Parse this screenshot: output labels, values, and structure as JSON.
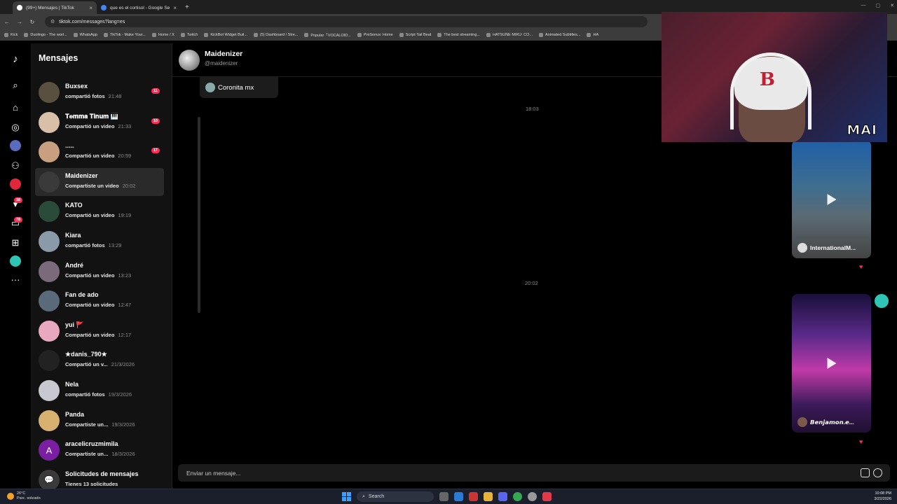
{
  "browser": {
    "tabs": [
      {
        "title": "(99+) Mensajes | TikTok",
        "active": true
      },
      {
        "title": "que es el cortisol - Google Sear",
        "active": false
      }
    ],
    "url": "tiktok.com/messages?lang=es",
    "bookmarks": [
      "Kick",
      "Duolingo - The worl...",
      "WhatsApp",
      "TikTok - Make Your...",
      "Home / X",
      "Twitch",
      "KickBot Widget Buil...",
      "(5) Dashboard / Stre...",
      "Popular「VOCALOID...",
      "PreSonus: Home",
      "Script Tail Beat",
      "The best streaming...",
      "HATSUNE MIKU: CO...",
      "Animated Subtitles...",
      "HA"
    ]
  },
  "rail": {
    "badges": {
      "notifications": "38",
      "messages": "78"
    }
  },
  "sidebar": {
    "title": "Mensajes",
    "conversations": [
      {
        "name": "Buxsex",
        "preview": "compartió fotos",
        "time": "21:48",
        "badge": "11",
        "initial": ""
      },
      {
        "name": "𝐓𝐞𝐦𝐦𝐚 𝐓𝐢𝐧𝐮𝐦 🎹",
        "preview": "Compartió un video",
        "time": "21:33",
        "badge": "10",
        "initial": ""
      },
      {
        "name": ".....",
        "preview": "Compartió un video",
        "time": "20:59",
        "badge": "17",
        "initial": ""
      },
      {
        "name": "Maidenizer",
        "preview": "Compartiste un video",
        "time": "20:02",
        "badge": "",
        "initial": ""
      },
      {
        "name": "KATO",
        "preview": "Compartió un video",
        "time": "19:19",
        "badge": "",
        "initial": ""
      },
      {
        "name": "Kiara",
        "preview": "compartió fotos",
        "time": "13:29",
        "badge": "",
        "initial": ""
      },
      {
        "name": "André",
        "preview": "Compartió un video",
        "time": "13:23",
        "badge": "",
        "initial": ""
      },
      {
        "name": "Fan de ado",
        "preview": "Compartió un video",
        "time": "12:47",
        "badge": "",
        "initial": ""
      },
      {
        "name": "yui 🚩",
        "preview": "Compartió un video",
        "time": "12:17",
        "badge": "",
        "initial": ""
      },
      {
        "name": "★danis_790★",
        "preview": "Compartió un v...",
        "time": "21/3/2026",
        "badge": "",
        "initial": ""
      },
      {
        "name": "Nela",
        "preview": "compartió fotos",
        "time": "19/3/2026",
        "badge": "",
        "initial": ""
      },
      {
        "name": "Panda",
        "preview": "Compartiste un...",
        "time": "19/3/2026",
        "badge": "",
        "initial": ""
      },
      {
        "name": "aracelicruzmimila",
        "preview": "Compartiste un...",
        "time": "18/3/2026",
        "badge": "",
        "initial": "A"
      },
      {
        "name": "Solicitudes de mensajes",
        "preview": "Tienes 13 solicitudes",
        "time": "",
        "badge": "",
        "initial": ""
      }
    ]
  },
  "chat": {
    "name": "Maidenizer",
    "handle": "@maidenizer",
    "old_card_author": "Coronita mx",
    "timestamps": [
      "18:03",
      "20:02"
    ],
    "videos": [
      {
        "author": "InternationalM..."
      },
      {
        "author": "𝘽𝙚𝙣𝙟𝙖𝙢𝙤𝙣.𝙚..."
      }
    ],
    "composer_placeholder": "Enviar un mensaje..."
  },
  "webcam": {
    "label": "MAI"
  },
  "taskbar": {
    "weather_temp": "26°C",
    "weather_desc": "Parc. soleado",
    "search": "Search",
    "time": "10:08 PM",
    "date": "3/22/2026"
  },
  "colors": {
    "accent": "#fe2c55",
    "bg": "#000000",
    "panel": "#121212"
  }
}
